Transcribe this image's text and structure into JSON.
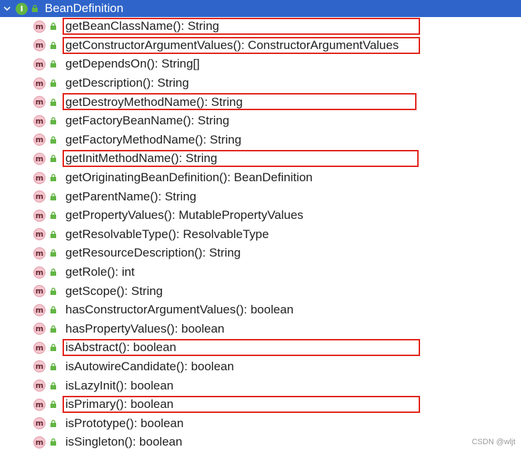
{
  "header": {
    "interface_badge": "I",
    "title": "BeanDefinition"
  },
  "method_badge": "m",
  "colors": {
    "header_bg": "#2f65ca",
    "highlight": "#e2231a",
    "method_badge_bg": "#f4c7cf",
    "interface_badge_bg": "#62b543",
    "lock": "#62b543"
  },
  "methods": [
    {
      "label": "getBeanClassName(): String",
      "highlighted": true
    },
    {
      "label": "getConstructorArgumentValues(): ConstructorArgumentValues",
      "highlighted": true
    },
    {
      "label": "getDependsOn(): String[]",
      "highlighted": false
    },
    {
      "label": "getDescription(): String",
      "highlighted": false
    },
    {
      "label": "getDestroyMethodName(): String",
      "highlighted": true
    },
    {
      "label": "getFactoryBeanName(): String",
      "highlighted": false
    },
    {
      "label": "getFactoryMethodName(): String",
      "highlighted": false
    },
    {
      "label": "getInitMethodName(): String",
      "highlighted": true
    },
    {
      "label": "getOriginatingBeanDefinition(): BeanDefinition",
      "highlighted": false
    },
    {
      "label": "getParentName(): String",
      "highlighted": false
    },
    {
      "label": "getPropertyValues(): MutablePropertyValues",
      "highlighted": false
    },
    {
      "label": "getResolvableType(): ResolvableType",
      "highlighted": false
    },
    {
      "label": "getResourceDescription(): String",
      "highlighted": false
    },
    {
      "label": "getRole(): int",
      "highlighted": false
    },
    {
      "label": "getScope(): String",
      "highlighted": false
    },
    {
      "label": "hasConstructorArgumentValues(): boolean",
      "highlighted": false
    },
    {
      "label": "hasPropertyValues(): boolean",
      "highlighted": false
    },
    {
      "label": "isAbstract(): boolean",
      "highlighted": true
    },
    {
      "label": "isAutowireCandidate(): boolean",
      "highlighted": false
    },
    {
      "label": "isLazyInit(): boolean",
      "highlighted": false
    },
    {
      "label": "isPrimary(): boolean",
      "highlighted": true
    },
    {
      "label": "isPrototype(): boolean",
      "highlighted": false
    },
    {
      "label": "isSingleton(): boolean",
      "highlighted": false
    }
  ],
  "watermark": "CSDN @wljt"
}
